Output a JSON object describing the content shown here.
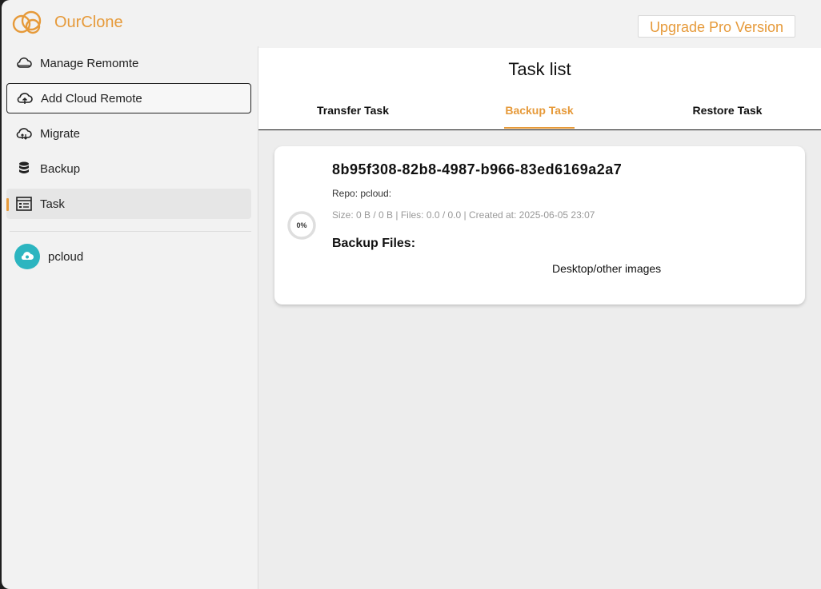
{
  "app": {
    "title": "OurClone",
    "upgrade_label": "Upgrade Pro Version",
    "accent_color": "#e69a3a"
  },
  "sidebar": {
    "items": [
      {
        "label": "Manage Remomte",
        "icon": "cloud-manage-icon"
      },
      {
        "label": "Add Cloud Remote",
        "icon": "cloud-upload-icon"
      },
      {
        "label": "Migrate",
        "icon": "cloud-migrate-icon"
      },
      {
        "label": "Backup",
        "icon": "database-icon"
      },
      {
        "label": "Task",
        "icon": "task-list-icon"
      }
    ],
    "remotes": [
      {
        "label": "pcloud",
        "icon": "pcloud-icon",
        "color": "#2cb5c0"
      }
    ]
  },
  "main": {
    "title": "Task list",
    "tabs": [
      {
        "label": "Transfer Task"
      },
      {
        "label": "Backup Task",
        "active": true
      },
      {
        "label": "Restore Task"
      }
    ],
    "task": {
      "id": "8b95f308-82b8-4987-b966-83ed6169a2a7",
      "repo": "Repo: pcloud:",
      "meta": "Size: 0 B / 0 B | Files: 0.0 / 0.0 | Created at: 2025-06-05 23:07",
      "progress_label": "0%",
      "progress_value": 0,
      "backup_files_label": "Backup Files:",
      "files": [
        "Desktop/other images"
      ]
    }
  }
}
